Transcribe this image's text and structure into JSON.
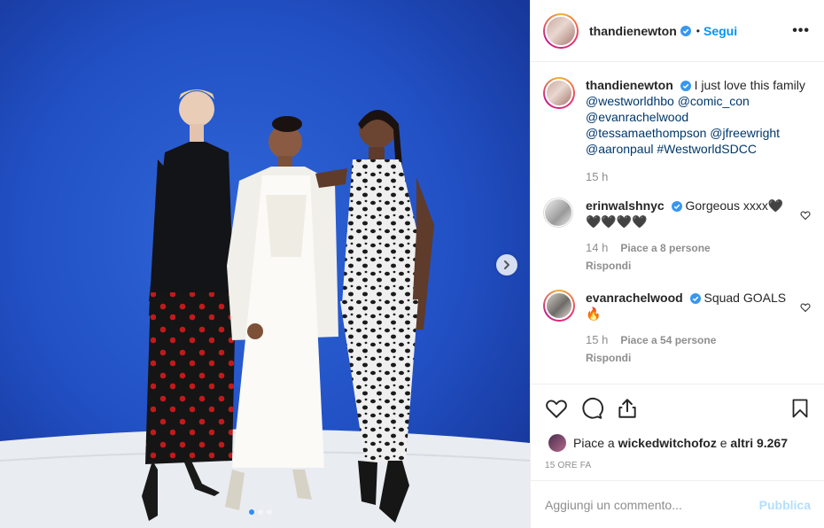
{
  "header": {
    "username": "thandienewton",
    "bullet": "•",
    "follow_label": "Segui",
    "more_label": "•••"
  },
  "caption": {
    "username": "thandienewton",
    "text": "I just love this family",
    "mentions_line1": "@westworldhbo @comic_con",
    "mentions_line2": "@evanrachelwood",
    "mentions_line3": "@tessamaethompson @jfreewright",
    "mentions_line4": "@aaronpaul #WestworldSDCC",
    "time": "15 h"
  },
  "comments": [
    {
      "username": "erinwalshnyc",
      "text": "Gorgeous xxxx🖤",
      "text2": "🖤🖤🖤🖤",
      "time": "14 h",
      "likes": "Piace a 8 persone",
      "reply": "Rispondi"
    },
    {
      "username": "evanrachelwood",
      "text": "Squad GOALS",
      "text2": "🔥",
      "time": "15 h",
      "likes": "Piace a 54 persone",
      "reply": "Rispondi"
    }
  ],
  "likes_bar": {
    "prefix": "Piace a",
    "user": "wickedwitchofoz",
    "conj": "e",
    "others": "altri 9.267"
  },
  "timestamp": "15 ORE FA",
  "add_comment": {
    "placeholder": "Aggiungi un commento...",
    "publish_label": "Pubblica"
  },
  "carousel": {
    "count": 3,
    "active_index": 0
  },
  "colors": {
    "accent": "#0095f6",
    "backdrop_blue": "#1f47b8",
    "verified": "#3897f0"
  },
  "icons": {
    "verified": "verified-badge-icon",
    "heart": "heart-icon",
    "comment": "comment-bubble-icon",
    "share": "share-icon",
    "bookmark": "bookmark-icon",
    "next": "chevron-right-icon"
  }
}
